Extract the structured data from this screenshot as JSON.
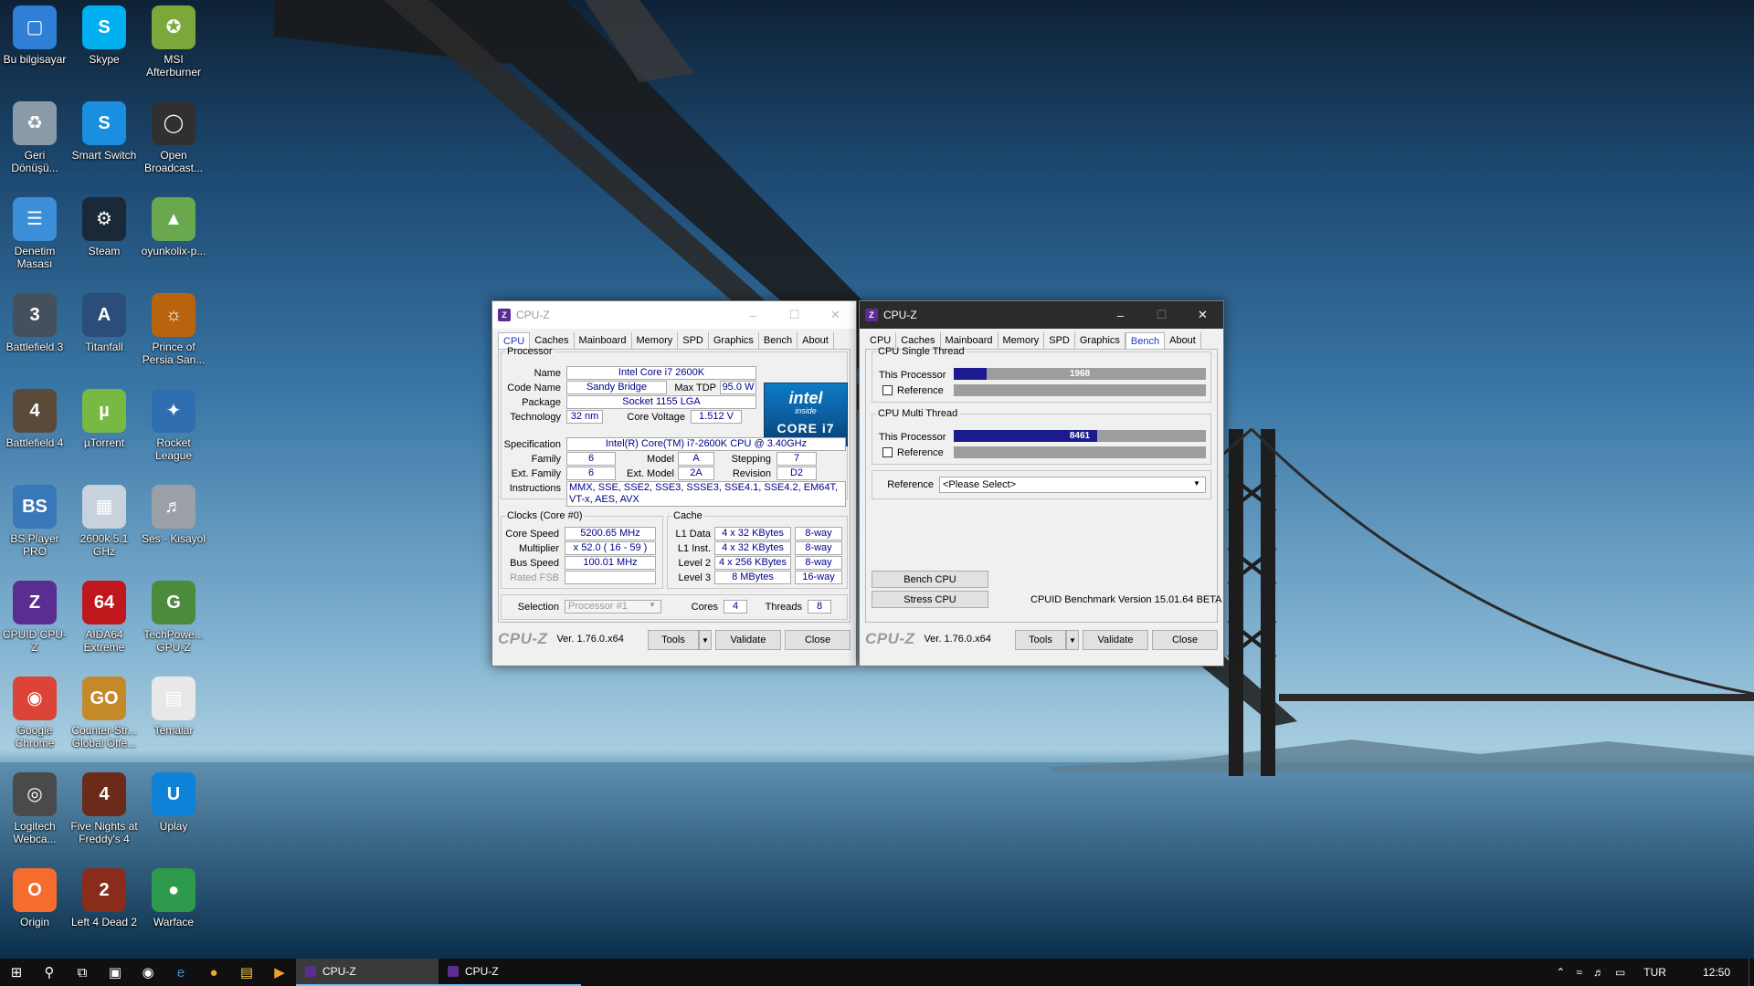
{
  "desktop_icons": [
    {
      "label": "Bu bilgisayar",
      "icon": "computer-icon",
      "color": "#2f7fd6"
    },
    {
      "label": "Skype",
      "icon": "skype-icon",
      "color": "#00aff0"
    },
    {
      "label": "MSI Afterburner",
      "icon": "afterburner-icon",
      "color": "#7aa83a"
    },
    {
      "label": "Geri Dönüşü...",
      "icon": "recycle-bin-icon",
      "color": "#8a9aa8"
    },
    {
      "label": "Smart Switch",
      "icon": "smart-switch-icon",
      "color": "#1a8fe0"
    },
    {
      "label": "Open Broadcast...",
      "icon": "obs-icon",
      "color": "#303030"
    },
    {
      "label": "Denetim Masası",
      "icon": "control-panel-icon",
      "color": "#3d8ed8"
    },
    {
      "label": "Steam",
      "icon": "steam-icon",
      "color": "#1b2838"
    },
    {
      "label": "oyunkolix-p...",
      "icon": "joystick-icon",
      "color": "#6aa84f"
    },
    {
      "label": "Battlefield 3",
      "icon": "battlefield3-icon",
      "color": "#44515c"
    },
    {
      "label": "Titanfall",
      "icon": "titanfall-icon",
      "color": "#2b4d7a"
    },
    {
      "label": "Prince of Persia San...",
      "icon": "prince-of-persia-icon",
      "color": "#b8640f"
    },
    {
      "label": "Battlefield 4",
      "icon": "battlefield4-icon",
      "color": "#5b4a3a"
    },
    {
      "label": "µTorrent",
      "icon": "utorrent-icon",
      "color": "#78b943"
    },
    {
      "label": "Rocket League",
      "icon": "rocket-league-icon",
      "color": "#2f6fb0"
    },
    {
      "label": "BS.Player PRO",
      "icon": "bsplayer-icon",
      "color": "#3978b8"
    },
    {
      "label": "2600k 5.1 GHz",
      "icon": "image-file-icon",
      "color": "#c8d2dc"
    },
    {
      "label": "Ses - Kisayol",
      "icon": "speaker-icon",
      "color": "#9aa0a6"
    },
    {
      "label": "CPUID CPU-Z",
      "icon": "cpuz-icon",
      "color": "#5a2d91"
    },
    {
      "label": "AIDA64 Extreme",
      "icon": "aida64-icon",
      "color": "#c0171d"
    },
    {
      "label": "TechPowe... GPU-Z",
      "icon": "gpuz-icon",
      "color": "#4c8a3c"
    },
    {
      "label": "Google Chrome",
      "icon": "chrome-icon",
      "color": "#db4437"
    },
    {
      "label": "Counter-Str... Global Offe...",
      "icon": "csgo-icon",
      "color": "#c48a2a"
    },
    {
      "label": "Temalar",
      "icon": "document-icon",
      "color": "#e8e8e8"
    },
    {
      "label": "Logitech Webca...",
      "icon": "webcam-icon",
      "color": "#4a4a4a"
    },
    {
      "label": "Five Nights at Freddy's 4",
      "icon": "fnaf-icon",
      "color": "#6b2a1a"
    },
    {
      "label": "Uplay",
      "icon": "uplay-icon",
      "color": "#0e82d6"
    },
    {
      "label": "Origin",
      "icon": "origin-icon",
      "color": "#f56c2d"
    },
    {
      "label": "Left 4 Dead 2",
      "icon": "l4d2-icon",
      "color": "#8a2c1c"
    },
    {
      "label": "Warface",
      "icon": "globe-icon",
      "color": "#2d9a4e"
    }
  ],
  "tabs": [
    "CPU",
    "Caches",
    "Mainboard",
    "Memory",
    "SPD",
    "Graphics",
    "Bench",
    "About"
  ],
  "cpu_window": {
    "title": "CPU-Z",
    "selected_tab": "CPU",
    "processor": {
      "legend": "Processor",
      "name_label": "Name",
      "name": "Intel Core i7 2600K",
      "codename_label": "Code Name",
      "codename": "Sandy Bridge",
      "tdp_label": "Max TDP",
      "tdp": "95.0 W",
      "package_label": "Package",
      "package": "Socket 1155 LGA",
      "technology_label": "Technology",
      "technology": "32 nm",
      "voltage_label": "Core Voltage",
      "voltage": "1.512 V",
      "spec_label": "Specification",
      "spec": "Intel(R) Core(TM) i7-2600K CPU @ 3.40GHz",
      "family_label": "Family",
      "family": "6",
      "model_label": "Model",
      "model": "A",
      "stepping_label": "Stepping",
      "stepping": "7",
      "extfamily_label": "Ext. Family",
      "extfamily": "6",
      "extmodel_label": "Ext. Model",
      "extmodel": "2A",
      "revision_label": "Revision",
      "revision": "D2",
      "instructions_label": "Instructions",
      "instructions": "MMX, SSE, SSE2, SSE3, SSSE3, SSE4.1, SSE4.2, EM64T, VT-x, AES, AVX"
    },
    "intel_logo": {
      "line1": "intel",
      "line2": "inside",
      "line3": "CORE i7"
    },
    "clocks": {
      "legend": "Clocks (Core #0)",
      "corespeed_label": "Core Speed",
      "corespeed": "5200.65 MHz",
      "multiplier_label": "Multiplier",
      "multiplier": "x 52.0 ( 16 - 59 )",
      "busspeed_label": "Bus Speed",
      "busspeed": "100.01 MHz",
      "ratedfsb_label": "Rated FSB",
      "ratedfsb": ""
    },
    "cache": {
      "legend": "Cache",
      "l1d_label": "L1 Data",
      "l1d": "4 x 32 KBytes",
      "l1d_way": "8-way",
      "l1i_label": "L1 Inst.",
      "l1i": "4 x 32 KBytes",
      "l1i_way": "8-way",
      "l2_label": "Level 2",
      "l2": "4 x 256 KBytes",
      "l2_way": "8-way",
      "l3_label": "Level 3",
      "l3": "8 MBytes",
      "l3_way": "16-way"
    },
    "selection_label": "Selection",
    "selection": "Processor #1",
    "cores_label": "Cores",
    "cores": "4",
    "threads_label": "Threads",
    "threads": "8"
  },
  "bench_window": {
    "title": "CPU-Z",
    "selected_tab": "Bench",
    "single": {
      "legend": "CPU Single Thread",
      "this_label": "This Processor",
      "this_value": "1968",
      "fill_fraction": 0.13,
      "ref_label": "Reference"
    },
    "multi": {
      "legend": "CPU Multi Thread",
      "this_label": "This Processor",
      "this_value": "8461",
      "fill_fraction": 0.57,
      "ref_label": "Reference"
    },
    "reference_label": "Reference",
    "reference_select": "<Please Select>",
    "bench_cpu": "Bench CPU",
    "stress_cpu": "Stress CPU",
    "bench_version": "CPUID Benchmark Version 15.01.64 BETA"
  },
  "footer": {
    "brand": "CPU-Z",
    "version": "Ver. 1.76.0.x64",
    "tools": "Tools",
    "validate": "Validate",
    "close": "Close"
  },
  "taskbar": {
    "tasks": [
      "CPU-Z",
      "CPU-Z"
    ],
    "language": "TUR",
    "time": "12:50"
  },
  "colors": {
    "accent_tab": "#1a38c8",
    "value_text": "#00008b",
    "bench_fill": "#1b1b8f",
    "taskbar": "#101010"
  }
}
